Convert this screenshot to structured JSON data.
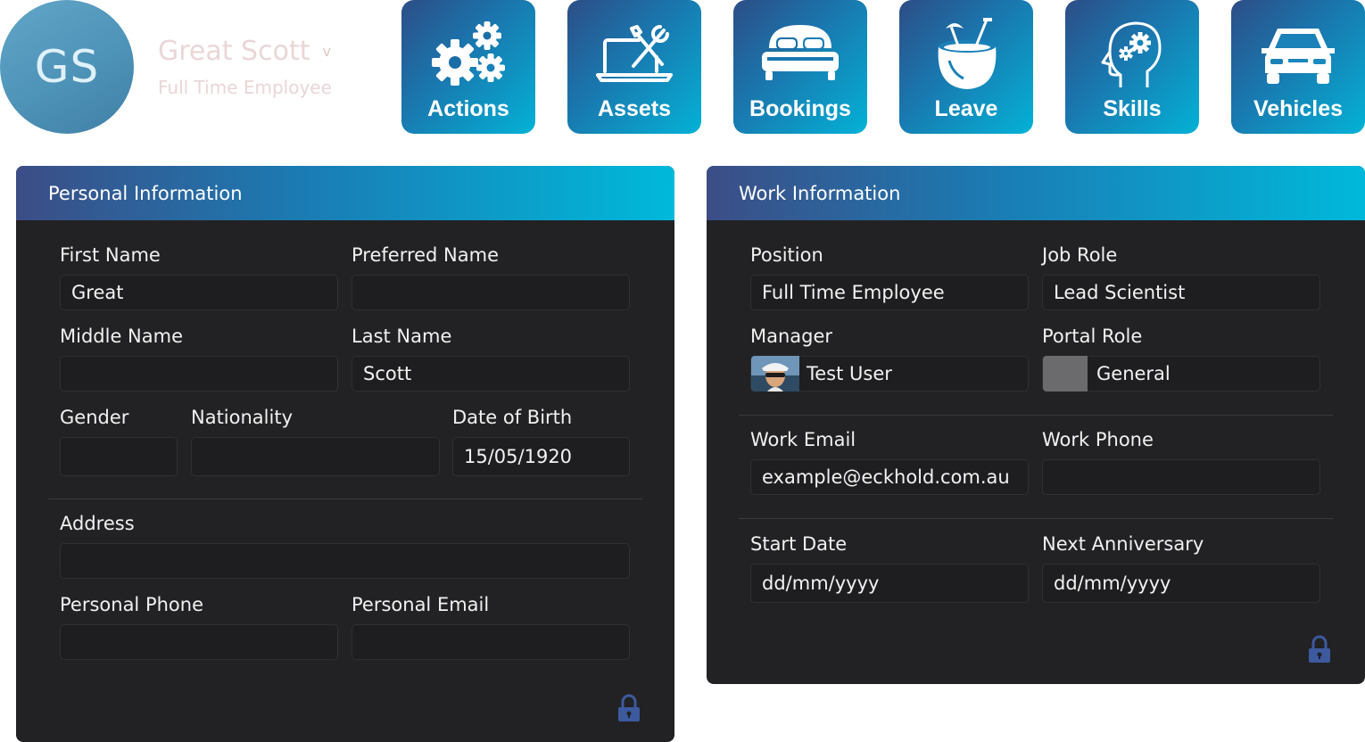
{
  "user": {
    "initials": "GS",
    "name": "Great Scott",
    "caret": "v",
    "role": "Full Time Employee"
  },
  "nav": {
    "tiles": [
      {
        "label": "Actions",
        "icon": "gears-icon"
      },
      {
        "label": "Assets",
        "icon": "laptop-tools-icon"
      },
      {
        "label": "Bookings",
        "icon": "bed-icon"
      },
      {
        "label": "Leave",
        "icon": "coconut-drink-icon"
      },
      {
        "label": "Skills",
        "icon": "head-gears-icon"
      },
      {
        "label": "Vehicles",
        "icon": "car-icon"
      }
    ]
  },
  "personal": {
    "title": "Personal Information",
    "first_name": {
      "label": "First Name",
      "value": "Great"
    },
    "preferred_name": {
      "label": "Preferred Name",
      "value": ""
    },
    "middle_name": {
      "label": "Middle Name",
      "value": ""
    },
    "last_name": {
      "label": "Last Name",
      "value": "Scott"
    },
    "gender": {
      "label": "Gender",
      "value": ""
    },
    "nationality": {
      "label": "Nationality",
      "value": ""
    },
    "dob": {
      "label": "Date of Birth",
      "value": "15/05/1920"
    },
    "address": {
      "label": "Address",
      "value": ""
    },
    "phone": {
      "label": "Personal Phone",
      "value": ""
    },
    "email": {
      "label": "Personal Email",
      "value": ""
    }
  },
  "work": {
    "title": "Work Information",
    "position": {
      "label": "Position",
      "value": "Full Time Employee"
    },
    "job_role": {
      "label": "Job Role",
      "value": "Lead Scientist"
    },
    "manager": {
      "label": "Manager",
      "value": "Test User"
    },
    "portal_role": {
      "label": "Portal Role",
      "value": "General"
    },
    "work_email": {
      "label": "Work Email",
      "value": "example@eckhold.com.au"
    },
    "work_phone": {
      "label": "Work Phone",
      "value": ""
    },
    "start_date": {
      "label": "Start Date",
      "placeholder": "dd/mm/yyyy"
    },
    "next_anniversary": {
      "label": "Next Anniversary",
      "placeholder": "dd/mm/yyyy"
    }
  },
  "colors": {
    "tile_gradient_start": "#2d4d86",
    "tile_gradient_end": "#03b2d6",
    "panel_bg": "#222224",
    "lock_icon": "#3d5a9e",
    "avatar_bg": "#4e93b8"
  }
}
